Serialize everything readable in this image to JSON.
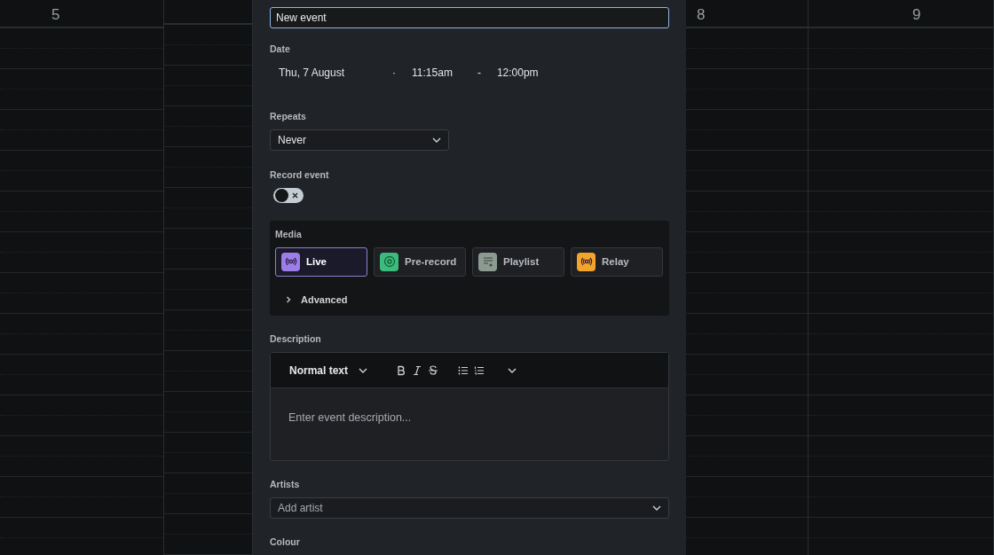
{
  "calendar": {
    "days": [
      {
        "label": "5"
      },
      {
        "label": "8"
      },
      {
        "label": "9"
      }
    ]
  },
  "event_form": {
    "title_field": {
      "value": "New event"
    },
    "date": {
      "label": "Date",
      "day": "Thu, 7 August",
      "separator_1": "·",
      "start": "11:15am",
      "separator_2": "-",
      "end": "12:00pm"
    },
    "repeats": {
      "label": "Repeats",
      "value": "Never"
    },
    "record_event": {
      "label": "Record event",
      "checked": false
    },
    "media": {
      "label": "Media",
      "options": [
        {
          "label": "Live",
          "color": "#9b7ee8",
          "kind": "broadcast",
          "selected": true
        },
        {
          "label": "Pre-record",
          "color": "#3dbb7f",
          "kind": "disc",
          "selected": false
        },
        {
          "label": "Playlist",
          "color": "#8c9a92",
          "kind": "playlist",
          "selected": false
        },
        {
          "label": "Relay",
          "color": "#f5a42a",
          "kind": "broadcast",
          "selected": false
        }
      ],
      "advanced": {
        "label": "Advanced",
        "expanded": false
      }
    },
    "description": {
      "label": "Description",
      "toolbar": {
        "style": "Normal text"
      },
      "placeholder": "Enter event description..."
    },
    "artists": {
      "label": "Artists",
      "placeholder": "Add artist"
    },
    "colour": {
      "label": "Colour"
    }
  }
}
